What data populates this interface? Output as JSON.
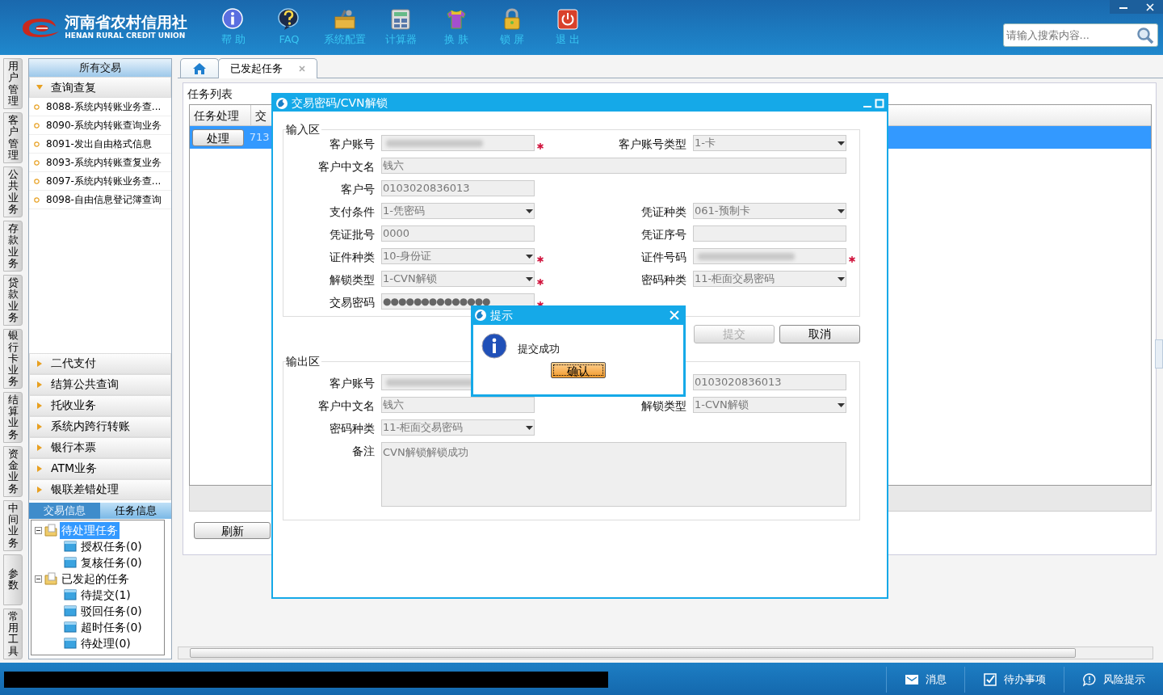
{
  "header": {
    "logo_title": "河南省农村信用社",
    "logo_subtitle": "HENAN RURAL CREDIT UNION",
    "toolbar": [
      {
        "kind": "info",
        "label": "帮 助"
      },
      {
        "kind": "faq",
        "label": "FAQ"
      },
      {
        "kind": "config",
        "label": "系统配置"
      },
      {
        "kind": "calc",
        "label": "计算器"
      },
      {
        "kind": "skin",
        "label": "换 肤"
      },
      {
        "kind": "lock",
        "label": "锁 屏"
      },
      {
        "kind": "exit",
        "label": "退 出"
      }
    ],
    "search": {
      "placeholder": "请输入搜索内容..."
    }
  },
  "side_tabs": [
    "用户管理",
    "客户管理",
    "公共业务",
    "存款业务",
    "贷款业务",
    "银行卡业务",
    "结算业务",
    "资金业务",
    "中间业务",
    "参数",
    "常用工具"
  ],
  "sidebar": {
    "title": "所有交易",
    "groups": [
      {
        "label": "查询查复",
        "expanded": true,
        "items": [
          "8088-系统内转账业务查...",
          "8090-系统内转账查询业务",
          "8091-发出自由格式信息",
          "8093-系统内转账查复业务",
          "8097-系统内转账业务查...",
          "8098-自由信息登记簿查询"
        ]
      },
      {
        "label": "二代支付",
        "expanded": false
      },
      {
        "label": "结算公共查询",
        "expanded": false
      },
      {
        "label": "托收业务",
        "expanded": false
      },
      {
        "label": "系统内跨行转账",
        "expanded": false
      },
      {
        "label": "银行本票",
        "expanded": false
      },
      {
        "label": "ATM业务",
        "expanded": false
      },
      {
        "label": "银联差错处理",
        "expanded": false
      }
    ],
    "info_tabs": [
      {
        "label": "交易信息",
        "selected": false
      },
      {
        "label": "任务信息",
        "selected": true
      }
    ],
    "tree": [
      {
        "label": "待处理任务",
        "selected": true,
        "expanded": true,
        "children": [
          {
            "label": "授权任务(0)",
            "selected": false
          },
          {
            "label": "复核任务(0)",
            "selected": false
          }
        ]
      },
      {
        "label": "已发起的任务",
        "selected": false,
        "expanded": true,
        "children": [
          {
            "label": "待提交(1)",
            "selected": false
          },
          {
            "label": "驳回任务(0)",
            "selected": false
          },
          {
            "label": "超时任务(0)",
            "selected": false
          },
          {
            "label": "待处理(0)",
            "selected": false
          }
        ]
      }
    ]
  },
  "tabs": [
    {
      "kind": "home",
      "selected": false
    },
    {
      "kind": "page",
      "label": "已发起任务",
      "selected": true
    }
  ],
  "task_list": {
    "title": "任务列表",
    "columns": [
      "任务处理",
      "交"
    ],
    "rows": [
      {
        "action": "处理",
        "column_2": "713",
        "selected": true
      }
    ],
    "refresh": "刷新"
  },
  "dialog": {
    "title": "交易密码/CVN解锁",
    "input": {
      "title": "输入区",
      "rows": [
        [
          {
            "label": "客户账号",
            "kind": "redacted",
            "required": true
          },
          {
            "label": "客户账号类型",
            "kind": "select",
            "value": "1-卡"
          }
        ],
        [
          {
            "label": "客户中文名",
            "kind": "text",
            "value": "钱六",
            "wide": true
          }
        ],
        [
          {
            "label": "客户号",
            "kind": "text",
            "value": "0103020836013"
          }
        ],
        [
          {
            "label": "支付条件",
            "kind": "select",
            "value": "1-凭密码"
          },
          {
            "label": "凭证种类",
            "kind": "select",
            "value": "061-预制卡"
          }
        ],
        [
          {
            "label": "凭证批号",
            "kind": "text",
            "value": "0000"
          },
          {
            "label": "凭证序号",
            "kind": "text"
          }
        ],
        [
          {
            "label": "证件种类",
            "kind": "select",
            "value": "10-身份证",
            "required": true
          },
          {
            "label": "证件号码",
            "kind": "redacted",
            "required": true
          }
        ],
        [
          {
            "label": "解锁类型",
            "kind": "select",
            "value": "1-CVN解锁",
            "required": true
          },
          {
            "label": "密码种类",
            "kind": "select",
            "value": "11-柜面交易密码"
          }
        ],
        [
          {
            "label": "交易密码",
            "kind": "password",
            "value": "●●●●●●●●●●●●●●",
            "required": true
          }
        ]
      ]
    },
    "buttons": [
      {
        "label": "提交",
        "disabled": true
      },
      {
        "label": "取消",
        "disabled": false
      }
    ],
    "output": {
      "title": "输出区",
      "rows": [
        [
          {
            "label": "客户账号",
            "kind": "redacted"
          },
          {
            "kind": "text",
            "value": "0103020836013"
          }
        ],
        [
          {
            "label": "客户中文名",
            "kind": "text",
            "value": "钱六"
          },
          {
            "label": "解锁类型",
            "kind": "select",
            "value": "1-CVN解锁"
          }
        ],
        [
          {
            "label": "密码种类",
            "kind": "select",
            "value": "11-柜面交易密码"
          }
        ],
        [
          {
            "label": "备注",
            "kind": "textarea",
            "value": "CVN解锁解锁成功",
            "wide": true
          }
        ]
      ]
    }
  },
  "prompt": {
    "title": "提示",
    "message": "提交成功",
    "button": "确认"
  },
  "status_bar": {
    "redacted": true,
    "items": [
      {
        "kind": "message",
        "label": "消息"
      },
      {
        "kind": "todo",
        "label": "待办事项"
      },
      {
        "kind": "risk",
        "label": "风险提示"
      }
    ]
  }
}
